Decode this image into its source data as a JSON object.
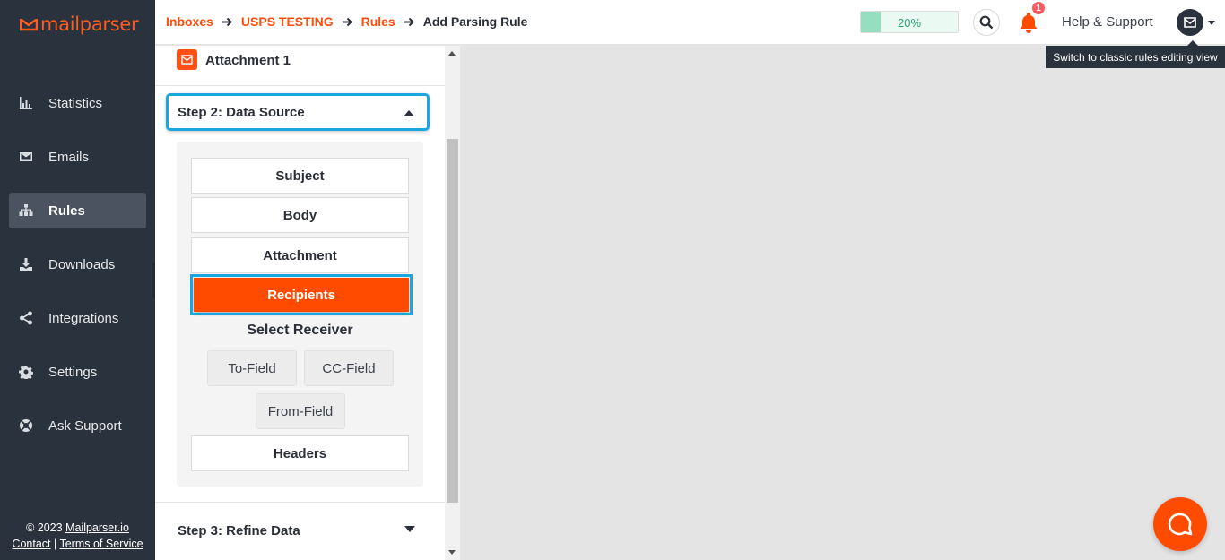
{
  "brand": {
    "name": "mailparser",
    "accent": "#ff4b00",
    "sidebar_bg": "#2a323d",
    "focus": "#1aa7e0"
  },
  "sidebar": {
    "items": [
      {
        "label": "Statistics",
        "icon": "bar-chart-icon"
      },
      {
        "label": "Emails",
        "icon": "envelope-icon"
      },
      {
        "label": "Rules",
        "icon": "sitemap-icon",
        "active": true
      },
      {
        "label": "Downloads",
        "icon": "download-icon"
      },
      {
        "label": "Integrations",
        "icon": "share-icon"
      },
      {
        "label": "Settings",
        "icon": "gear-icon"
      },
      {
        "label": "Ask Support",
        "icon": "lifebuoy-icon"
      }
    ],
    "footer": {
      "copyright": "© 2023 ",
      "site": "Mailparser.io",
      "contact": "Contact",
      "sep": " | ",
      "terms": "Terms of Service"
    }
  },
  "breadcrumb": [
    "Inboxes",
    "USPS TESTING",
    "Rules",
    "Add Parsing Rule"
  ],
  "header": {
    "progress": {
      "value": 0.2,
      "label": "20%"
    },
    "notifications_count": "1",
    "help": "Help & Support"
  },
  "tooltip": "Switch to classic rules editing view",
  "panel": {
    "attachment_label": "Attachment 1",
    "step2_title": "Step 2: Data Source",
    "sources": [
      "Subject",
      "Body",
      "Attachment",
      "Recipients",
      "Headers"
    ],
    "selected_source": "Recipients",
    "select_receiver": "Select Receiver",
    "receivers": [
      "To-Field",
      "CC-Field",
      "From-Field"
    ],
    "step3_title": "Step 3: Refine Data"
  }
}
